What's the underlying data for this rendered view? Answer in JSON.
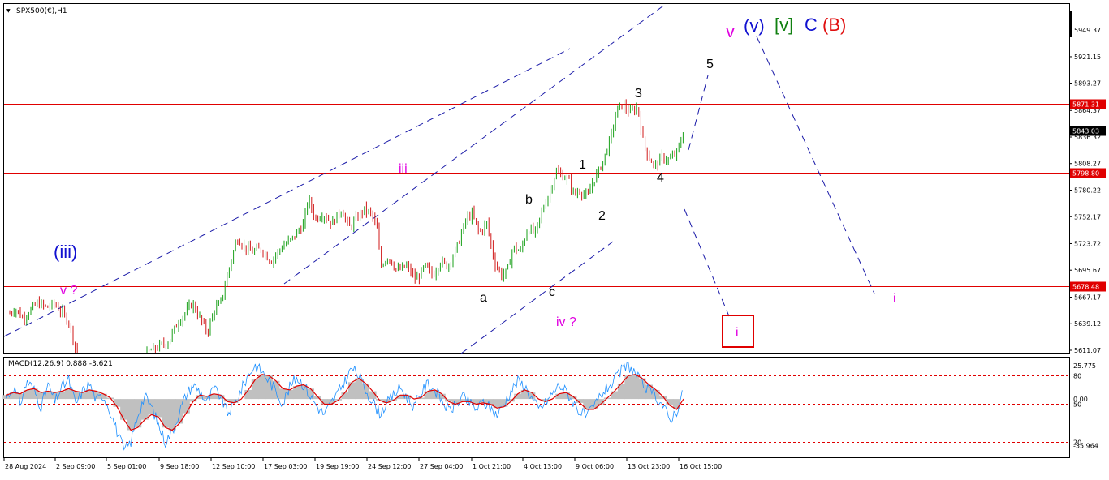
{
  "window": {
    "symbol_label": "SPX500(€),H1",
    "symbol_arrow": "▼"
  },
  "chart_data": [
    {
      "type": "line",
      "subtype": "candlestick",
      "title": "SPX500(€),H1",
      "ylim": [
        5611.07,
        5977.5
      ],
      "y_ticks": [
        5949.37,
        5921.15,
        5893.27,
        5864.37,
        5836.32,
        5808.27,
        5780.22,
        5752.17,
        5723.72,
        5695.67,
        5667.17,
        5639.12,
        5611.07
      ],
      "x_ticks": [
        "28 Aug 2024",
        "2 Sep 09:00",
        "5 Sep 01:00",
        "9 Sep 18:00",
        "12 Sep 10:00",
        "17 Sep 03:00",
        "19 Sep 19:00",
        "24 Sep 12:00",
        "27 Sep 04:00",
        "1 Oct 21:00",
        "4 Oct 13:00",
        "9 Oct 06:00",
        "13 Oct 23:00",
        "16 Oct 15:00"
      ],
      "price_path": [
        [
          0,
          5650
        ],
        [
          0.3,
          5655
        ],
        [
          0.7,
          5645
        ],
        [
          1.5,
          5661
        ],
        [
          2,
          5656
        ],
        [
          2.4,
          5660
        ],
        [
          2.8,
          5651
        ],
        [
          3.2,
          5640
        ],
        [
          3.8,
          5590
        ],
        [
          4.5,
          5560
        ],
        [
          5.5,
          5545
        ],
        [
          6,
          5565
        ],
        [
          6.5,
          5590
        ],
        [
          7,
          5600
        ],
        [
          7.5,
          5610
        ],
        [
          8.5,
          5620
        ],
        [
          9,
          5640
        ],
        [
          9.4,
          5650
        ],
        [
          9.8,
          5661
        ],
        [
          10.2,
          5645
        ],
        [
          10.6,
          5630
        ],
        [
          11.0,
          5655
        ],
        [
          11.3,
          5660
        ],
        [
          11.8,
          5700
        ],
        [
          12.2,
          5730
        ],
        [
          12.6,
          5720
        ],
        [
          13.0,
          5715
        ],
        [
          13.5,
          5718
        ],
        [
          14.0,
          5705
        ],
        [
          14.6,
          5720
        ],
        [
          15.2,
          5730
        ],
        [
          15.8,
          5745
        ],
        [
          16.0,
          5772
        ],
        [
          16.4,
          5750
        ],
        [
          16.8,
          5755
        ],
        [
          17.3,
          5745
        ],
        [
          17.8,
          5760
        ],
        [
          18.2,
          5740
        ],
        [
          18.6,
          5750
        ],
        [
          19.0,
          5760
        ],
        [
          19.4,
          5755
        ],
        [
          19.7,
          5740
        ],
        [
          19.9,
          5700
        ],
        [
          20.3,
          5710
        ],
        [
          20.8,
          5695
        ],
        [
          21.3,
          5700
        ],
        [
          21.8,
          5685
        ],
        [
          22.3,
          5700
        ],
        [
          22.7,
          5690
        ],
        [
          23.1,
          5705
        ],
        [
          23.5,
          5700
        ],
        [
          24.0,
          5720
        ],
        [
          24.5,
          5750
        ],
        [
          24.8,
          5755
        ],
        [
          25.2,
          5735
        ],
        [
          25.6,
          5745
        ],
        [
          26.0,
          5705
        ],
        [
          26.4,
          5690
        ],
        [
          26.7,
          5695
        ],
        [
          27.0,
          5720
        ],
        [
          27.4,
          5715
        ],
        [
          27.8,
          5740
        ],
        [
          28.2,
          5735
        ],
        [
          28.6,
          5760
        ],
        [
          29.0,
          5780
        ],
        [
          29.3,
          5800
        ],
        [
          29.7,
          5795
        ],
        [
          30.0,
          5790
        ],
        [
          30.3,
          5775
        ],
        [
          30.6,
          5780
        ],
        [
          31.0,
          5772
        ],
        [
          31.3,
          5790
        ],
        [
          31.6,
          5800
        ],
        [
          32.0,
          5820
        ],
        [
          32.3,
          5840
        ],
        [
          32.6,
          5866
        ],
        [
          32.9,
          5870
        ],
        [
          33.3,
          5862
        ],
        [
          33.7,
          5868
        ],
        [
          34.0,
          5830
        ],
        [
          34.3,
          5815
        ],
        [
          34.6,
          5805
        ],
        [
          35.0,
          5815
        ],
        [
          35.4,
          5812
        ],
        [
          35.8,
          5820
        ],
        [
          36.2,
          5843
        ]
      ],
      "hlines": [
        {
          "value": 5871.31,
          "label": "5871.31",
          "color": "#e00000"
        },
        {
          "value": 5798.8,
          "label": "5798.80",
          "color": "#e00000"
        },
        {
          "value": 5678.48,
          "label": "5678.48",
          "color": "#e00000"
        },
        {
          "value": 5843.03,
          "label": "5843.03",
          "color": "#c0c0c0",
          "current": true
        }
      ],
      "wave_labels": [
        {
          "text": "v",
          "color": "#e000e0"
        },
        {
          "text": "(v)",
          "color": "#1010d0"
        },
        {
          "text": "[v]",
          "color": "#108010"
        },
        {
          "text": "C",
          "color": "#1010d0"
        },
        {
          "text": "(B)",
          "color": "#e01010"
        },
        {
          "text": "5",
          "color": "#000000"
        },
        {
          "text": "3",
          "color": "#000000"
        },
        {
          "text": "1",
          "color": "#000000"
        },
        {
          "text": "2",
          "color": "#000000"
        },
        {
          "text": "4",
          "color": "#000000"
        },
        {
          "text": "b",
          "color": "#000000"
        },
        {
          "text": "a",
          "color": "#000000"
        },
        {
          "text": "c",
          "color": "#000000"
        },
        {
          "text": "iii",
          "color": "#e000e0"
        },
        {
          "text": "iv ?",
          "color": "#e000e0"
        },
        {
          "text": "(iii)",
          "color": "#1010d0"
        },
        {
          "text": "v ?",
          "color": "#e000e0"
        },
        {
          "text": "i",
          "color": "#e000e0"
        },
        {
          "text": "i",
          "color": "#e000e0",
          "boxed": true,
          "box_color": "#e00000"
        }
      ],
      "projection_color": "#1a1aa8"
    },
    {
      "type": "line",
      "title": "MACD(12,26,9) 0.888 -3.621",
      "ylim": [
        -45,
        32
      ],
      "y_ticks_left_axis": [
        "25.775",
        "0.00",
        "-35.964"
      ],
      "level_labels": [
        "80",
        "50",
        "20"
      ],
      "macd_values": [
        1,
        9,
        -3,
        14,
        7,
        -6,
        11,
        -2,
        9,
        15,
        -4,
        6,
        12,
        -1,
        3,
        -9,
        -25,
        -40,
        -33,
        -12,
        2,
        -6,
        -20,
        -33,
        -25,
        -10,
        3,
        11,
        6,
        -3,
        8,
        2,
        -11,
        -4,
        7,
        19,
        26,
        21,
        14,
        6,
        -3,
        9,
        17,
        11,
        2,
        -6,
        -12,
        -3,
        5,
        14,
        24,
        18,
        7,
        -2,
        -11,
        -4,
        3,
        9,
        1,
        -6,
        5,
        12,
        7,
        -1,
        -9,
        -5,
        2,
        -3,
        -8,
        -2,
        -7,
        -12,
        -4,
        6,
        14,
        10,
        1,
        -8,
        -3,
        4,
        11,
        6,
        -2,
        -10,
        -14,
        -6,
        3,
        9,
        14,
        22,
        26,
        20,
        12,
        6,
        2,
        -5,
        -16,
        -9,
        6
      ],
      "signal_values": [
        3,
        5,
        4,
        7,
        8,
        5,
        6,
        5,
        6,
        8,
        6,
        5,
        7,
        6,
        4,
        1,
        -6,
        -16,
        -24,
        -22,
        -16,
        -12,
        -14,
        -22,
        -24,
        -19,
        -11,
        -2,
        3,
        2,
        4,
        3,
        -2,
        -3,
        0,
        7,
        15,
        19,
        18,
        14,
        8,
        7,
        10,
        11,
        8,
        2,
        -4,
        -4,
        -1,
        5,
        13,
        16,
        12,
        6,
        -1,
        -3,
        -1,
        3,
        3,
        0,
        1,
        6,
        7,
        4,
        -2,
        -4,
        -2,
        -2,
        -4,
        -3,
        -4,
        -7,
        -6,
        -2,
        4,
        7,
        5,
        0,
        -2,
        0,
        4,
        5,
        2,
        -3,
        -8,
        -8,
        -4,
        1,
        6,
        12,
        18,
        19,
        16,
        11,
        7,
        2,
        -5,
        -8,
        0
      ],
      "macd_color": "#1e90ff",
      "signal_color": "#e00000"
    }
  ]
}
